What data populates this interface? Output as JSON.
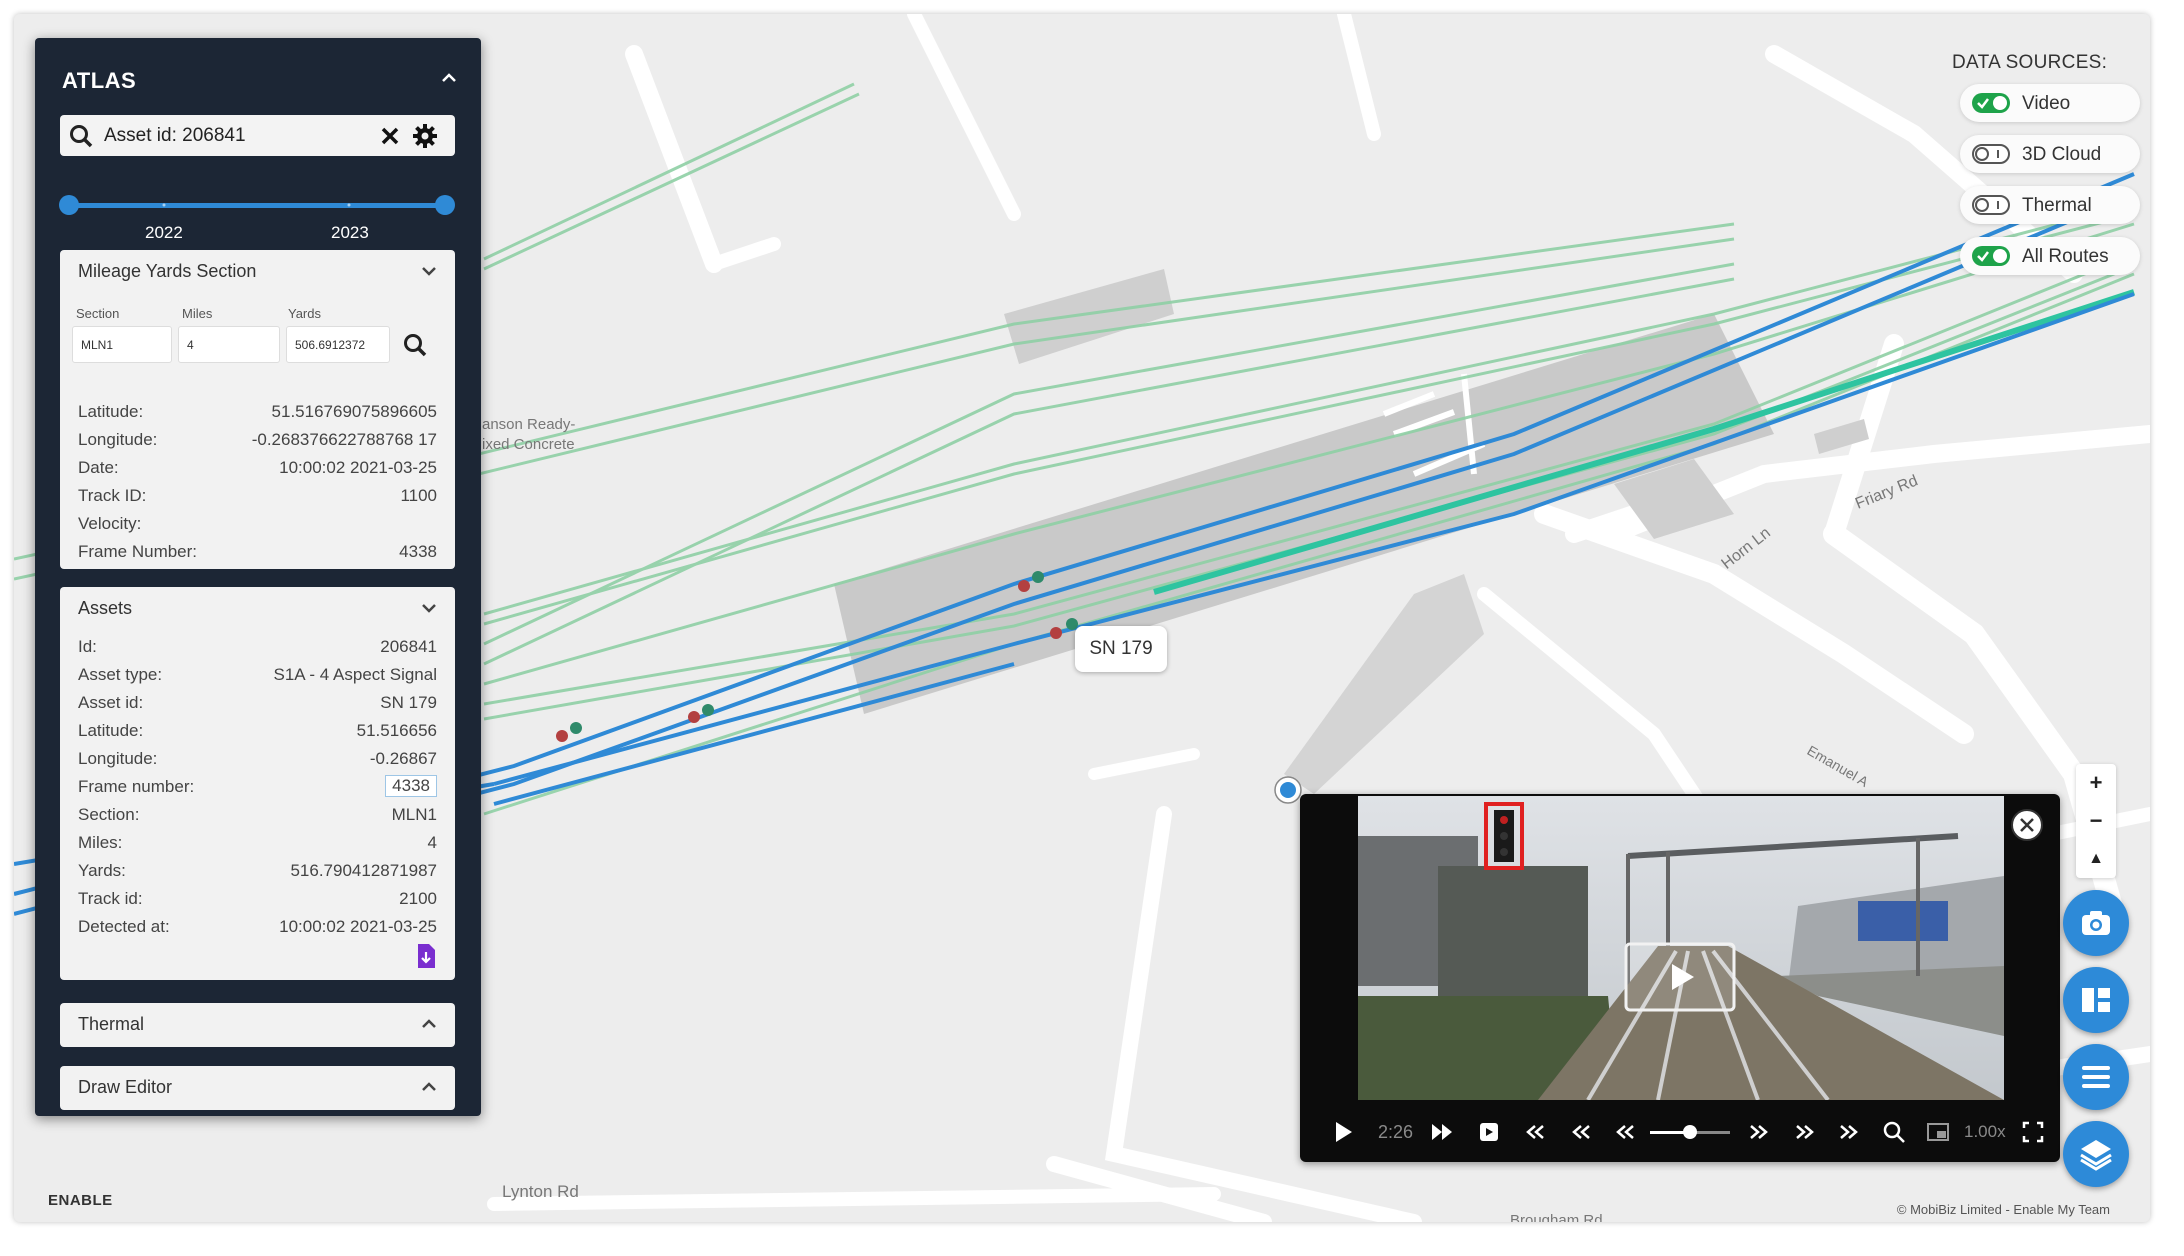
{
  "app": {
    "title": "ATLAS",
    "brand": "ENABLE",
    "attribution": "© MobiBiz Limited - Enable My Team"
  },
  "search": {
    "value": "Asset id: 206841"
  },
  "year_range": {
    "start_label": "2022",
    "end_label": "2023"
  },
  "mileage_panel": {
    "title": "Mileage Yards Section",
    "fields": [
      {
        "label": "Section",
        "value": "MLN1"
      },
      {
        "label": "Miles",
        "value": "4"
      },
      {
        "label": "Yards",
        "value": "506.6912372"
      }
    ],
    "info": [
      {
        "label": "Latitude:",
        "value": "51.516769075896605"
      },
      {
        "label": "Longitude:",
        "value": "-0.268376622788768 17"
      },
      {
        "label": "Date:",
        "value": "10:00:02 2021-03-25"
      },
      {
        "label": "Track ID:",
        "value": "1100"
      },
      {
        "label": "Velocity:",
        "value": ""
      },
      {
        "label": "Frame Number:",
        "value": "4338"
      }
    ]
  },
  "assets_panel": {
    "title": "Assets",
    "rows": [
      {
        "label": "Id:",
        "value": "206841"
      },
      {
        "label": "Asset type:",
        "value": "S1A - 4 Aspect Signal"
      },
      {
        "label": "Asset id:",
        "value": "SN 179"
      },
      {
        "label": "Latitude:",
        "value": "51.516656"
      },
      {
        "label": "Longitude:",
        "value": "-0.26867"
      },
      {
        "label": "Frame number:",
        "value": "4338"
      },
      {
        "label": "Section:",
        "value": "MLN1"
      },
      {
        "label": "Miles:",
        "value": "4"
      },
      {
        "label": "Yards:",
        "value": "516.790412871987"
      },
      {
        "label": "Track id:",
        "value": "2100"
      },
      {
        "label": "Detected at:",
        "value": "10:00:02 2021-03-25"
      }
    ]
  },
  "thermal_panel": {
    "title": "Thermal"
  },
  "draw_panel": {
    "title": "Draw Editor"
  },
  "data_sources": {
    "title": "DATA SOURCES:",
    "items": [
      {
        "label": "Video",
        "enabled": true
      },
      {
        "label": "3D Cloud",
        "enabled": false
      },
      {
        "label": "Thermal",
        "enabled": false
      },
      {
        "label": "All Routes",
        "enabled": true
      }
    ]
  },
  "map": {
    "tooltip": "SN 179",
    "labels": {
      "plant_line1": "anson Ready-",
      "plant_line2": "ixed Concrete",
      "friary": "Friary Rd",
      "horn": "Horn Ln",
      "emanuel": "Emanuel A",
      "lynton": "Lynton Rd",
      "brougham": "Brougham Rd"
    },
    "colors": {
      "route": "#2f8ad6",
      "track_green": "#8fd0a5",
      "highlight": "#2ec4a0",
      "road": "#ffffff",
      "building": "#cfcfcf"
    }
  },
  "video": {
    "time": "2:26",
    "speed": "1.00x"
  },
  "icons": [
    "search-icon",
    "close-icon",
    "gear-icon",
    "chevron-down-icon",
    "chevron-up-icon",
    "download-icon",
    "play-icon",
    "camera-icon",
    "layers-icon",
    "menu-icon",
    "split-icon",
    "fullscreen-icon"
  ]
}
